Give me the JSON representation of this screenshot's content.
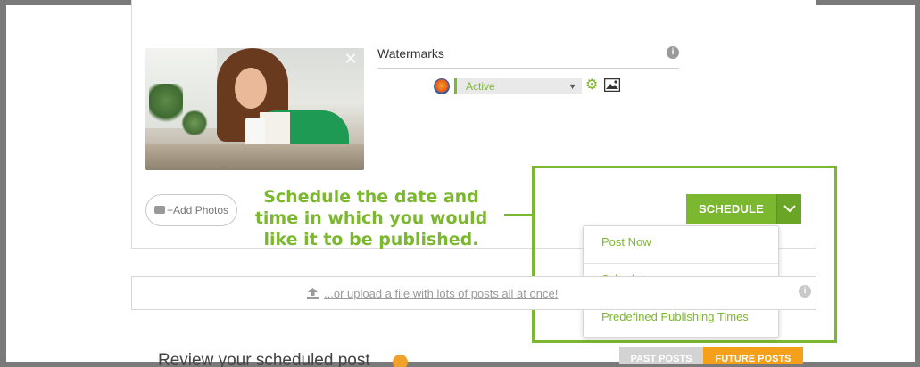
{
  "watermarks": {
    "title": "Watermarks",
    "info_icon": "info-icon",
    "selected": "Active",
    "colors": {
      "accent": "#7cb82f"
    }
  },
  "photo": {
    "close_glyph": "✕"
  },
  "add_photos": {
    "label": "+Add Photos",
    "icon": "camera-icon"
  },
  "callout": {
    "text": "Schedule the date and time in which you would like it to be published.",
    "color": "#7cb82f"
  },
  "schedule": {
    "button_label": "SCHEDULE",
    "menu_items": [
      "Post Now",
      "Schedule",
      "Predefined Publishing Times"
    ]
  },
  "upload": {
    "link_text": "...or upload a file with lots of posts all at once!",
    "icon": "upload-icon"
  },
  "review": {
    "title": "Review your scheduled post",
    "tabs": {
      "past": "PAST POSTS",
      "future": "FUTURE POSTS"
    },
    "colors": {
      "future": "#f5a01a",
      "past": "#d3d3d3"
    }
  }
}
